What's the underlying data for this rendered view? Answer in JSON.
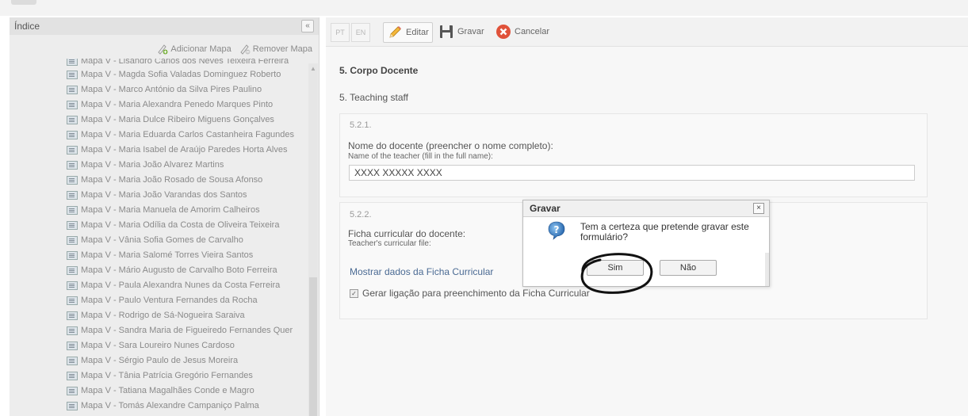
{
  "sidebar": {
    "title": "Índice",
    "collapse_label": "«",
    "add_map": "Adicionar Mapa",
    "remove_map": "Remover Mapa",
    "items": [
      {
        "label": "Mapa V - Lisandro Carlos dos Neves Teixeira Ferreira"
      },
      {
        "label": "Mapa V - Magda Sofia Valadas Dominguez Roberto"
      },
      {
        "label": "Mapa V - Marco António da Silva Pires Paulino"
      },
      {
        "label": "Mapa V - Maria Alexandra Penedo Marques Pinto"
      },
      {
        "label": "Mapa V - Maria Dulce Ribeiro Miguens Gonçalves"
      },
      {
        "label": "Mapa V - Maria Eduarda Carlos Castanheira Fagundes"
      },
      {
        "label": "Mapa V - Maria Isabel de Araújo Paredes Horta Alves"
      },
      {
        "label": "Mapa V - Maria João Alvarez Martins"
      },
      {
        "label": "Mapa V - Maria João Rosado de Sousa Afonso"
      },
      {
        "label": "Mapa V - Maria João Varandas dos Santos"
      },
      {
        "label": "Mapa V - Maria Manuela de Amorim Calheiros"
      },
      {
        "label": "Mapa V - Maria Odília da Costa de Oliveira Teixeira"
      },
      {
        "label": "Mapa V - Vânia Sofia Gomes de Carvalho"
      },
      {
        "label": "Mapa V - Maria Salomé Torres Vieira Santos"
      },
      {
        "label": "Mapa V - Mário Augusto de Carvalho Boto Ferreira"
      },
      {
        "label": "Mapa V - Paula Alexandra Nunes da Costa Ferreira"
      },
      {
        "label": "Mapa V - Paulo Ventura Fernandes da Rocha"
      },
      {
        "label": "Mapa V - Rodrigo de Sá-Nogueira Saraiva"
      },
      {
        "label": "Mapa V - Sandra Maria de Figueiredo Fernandes Quer"
      },
      {
        "label": "Mapa V - Sara Loureiro Nunes Cardoso"
      },
      {
        "label": "Mapa V - Sérgio Paulo de Jesus Moreira"
      },
      {
        "label": "Mapa V - Tânia Patrícia Gregório Fernandes"
      },
      {
        "label": "Mapa V - Tatiana Magalhães Conde e Magro"
      },
      {
        "label": "Mapa V - Tomás Alexandre Campaniço Palma"
      }
    ]
  },
  "toolbar": {
    "lang_pt": "PT",
    "lang_en": "EN",
    "edit": "Editar",
    "save": "Gravar",
    "cancel": "Cancelar"
  },
  "content": {
    "section_title": "5. Corpo Docente",
    "section_sub": "5. Teaching staff",
    "q1": {
      "num": "5.2.1.",
      "label_pt": "Nome do docente (preencher o nome completo):",
      "label_en": "Name of the teacher (fill in the full name):",
      "value": "XXXX XXXXX XXXX"
    },
    "q2": {
      "num": "5.2.2.",
      "label_pt": "Ficha curricular do docente:",
      "label_en": "Teacher's curricular file:",
      "link": "Mostrar dados da Ficha Curricular",
      "checkbox_label": "Gerar ligação para preenchimento da Ficha Curricular"
    }
  },
  "dialog": {
    "title": "Gravar",
    "close": "×",
    "message": "Tem a certeza que pretende gravar este formulário?",
    "yes": "Sim",
    "no": "Não"
  },
  "colors": {
    "accent_link": "#4a6a93",
    "cancel_red": "#e0523a",
    "highlight_ring": "#111111"
  }
}
